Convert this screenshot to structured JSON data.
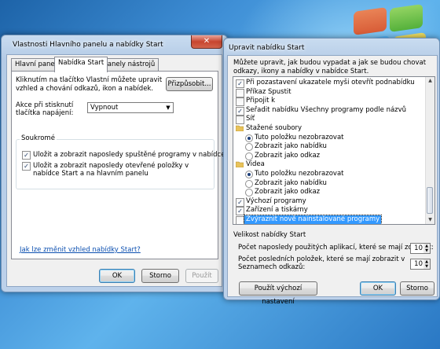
{
  "window_left": {
    "title": "Vlastnosti Hlavního panelu a nabídky Start",
    "tabs": [
      "Hlavní panel",
      "Nabídka Start",
      "Panely nástrojů"
    ],
    "description": "Kliknutím na tlačítko Vlastní můžete upravit vzhled a chování odkazů, ikon a nabídek.",
    "customize_button": "Přizpůsobit...",
    "power_action_label": "Akce při stisknutí tlačítka napájení:",
    "power_action_value": "Vypnout",
    "privacy_group": "Soukromé",
    "privacy_option_1": "Uložit a zobrazit naposledy spuštěné programy v nabídce Start",
    "privacy_option_2": "Uložit a zobrazit naposledy otevřené položky v nabídce Start a na hlavním panelu",
    "link": "Jak lze změnit vzhled nabídky Start?",
    "buttons": {
      "ok": "OK",
      "cancel": "Storno",
      "apply": "Použít"
    }
  },
  "window_right": {
    "title": "Upravit nabídku Start",
    "description": "Můžete upravit, jak budou vypadat a jak se budou chovat odkazy, ikony a nabídky v nabídce Start.",
    "list_items": [
      {
        "type": "checkbox",
        "checked": true,
        "label": "Při pozastavení ukazatele myši otevřít podnabídku"
      },
      {
        "type": "checkbox",
        "checked": false,
        "label": "Příkaz Spustit"
      },
      {
        "type": "checkbox",
        "checked": false,
        "label": "Připojit k"
      },
      {
        "type": "checkbox",
        "checked": true,
        "label": "Seřadit nabídku Všechny programy podle názvů"
      },
      {
        "type": "checkbox",
        "checked": false,
        "label": "Síť"
      },
      {
        "type": "folder",
        "label": "Stažené soubory"
      },
      {
        "type": "radio",
        "checked": true,
        "label": "Tuto položku nezobrazovat"
      },
      {
        "type": "radio",
        "checked": false,
        "label": "Zobrazit jako nabídku"
      },
      {
        "type": "radio",
        "checked": false,
        "label": "Zobrazit jako odkaz"
      },
      {
        "type": "folder",
        "label": "Videa"
      },
      {
        "type": "radio",
        "checked": true,
        "label": "Tuto položku nezobrazovat"
      },
      {
        "type": "radio",
        "checked": false,
        "label": "Zobrazit jako nabídku"
      },
      {
        "type": "radio",
        "checked": false,
        "label": "Zobrazit jako odkaz"
      },
      {
        "type": "checkbox",
        "checked": true,
        "label": "Výchozí programy"
      },
      {
        "type": "checkbox",
        "checked": true,
        "label": "Zařízení a tiskárny"
      },
      {
        "type": "checkbox",
        "checked": false,
        "label": "Zvýraznit nově nainstalované programy",
        "selected": true
      }
    ],
    "size_group": "Velikost nabídky Start",
    "recent_programs_label": "Počet naposledy použitých aplikací, které se mají zobrazit:",
    "recent_programs_value": "10",
    "recent_items_label": "Počet posledních položek, které se mají zobrazit v Seznamech odkazů:",
    "recent_items_value": "10",
    "defaults_button": "Použít výchozí nastavení",
    "buttons": {
      "ok": "OK",
      "cancel": "Storno"
    }
  },
  "icons": {
    "close": "close-icon",
    "dropdown": "chevron-down-icon",
    "folder": "folder-icon"
  }
}
